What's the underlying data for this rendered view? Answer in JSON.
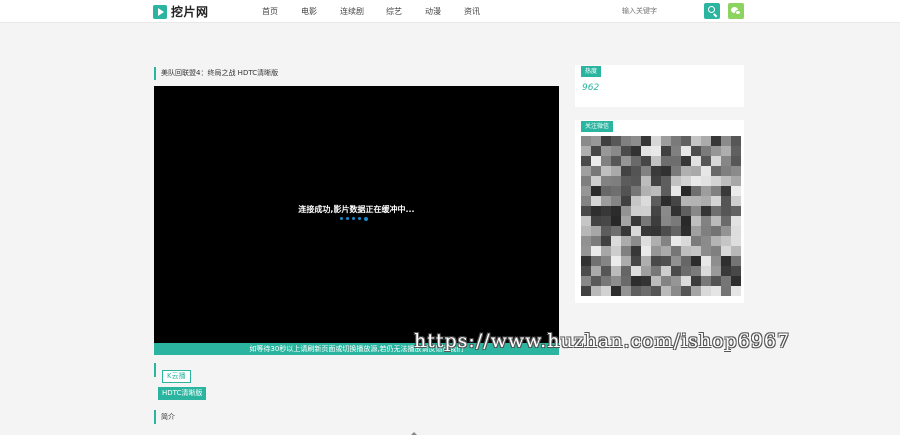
{
  "header": {
    "logo_text": "挖片网",
    "nav": [
      "首页",
      "电影",
      "连续剧",
      "综艺",
      "动漫",
      "资讯"
    ],
    "search_placeholder": "输入关键字"
  },
  "video": {
    "title": "美队回联盟4：终局之战 HDTC清晰版",
    "loading_message": "连接成功,影片数据正在缓冲中...",
    "bottom_notice": "如等待30秒以上请刷新页面或切换播放源,若仍无法播放请反馈给我们"
  },
  "sources": {
    "group_label": "K云播",
    "episode_label": "HDTC清晰版"
  },
  "intro": {
    "label": "简介"
  },
  "sidebar": {
    "hot_label": "热度",
    "hot_count": "962",
    "follow_label": "关注微信"
  },
  "watermark": "https://www.huzhan.com/ishop6967",
  "colors": {
    "accent": "#2bb5a0",
    "wechat": "#8dd35f",
    "loading_dots": "#1e88c8"
  }
}
